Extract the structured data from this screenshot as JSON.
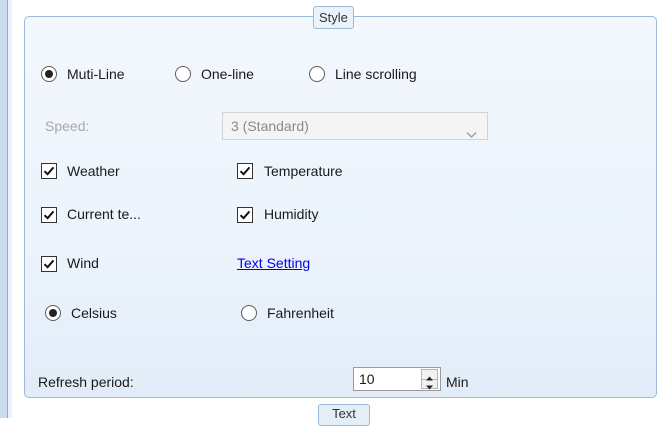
{
  "group": {
    "title": "Style",
    "bottom_tab": "Text"
  },
  "mode": {
    "options": [
      {
        "label": "Muti-Line",
        "selected": true
      },
      {
        "label": "One-line",
        "selected": false
      },
      {
        "label": "Line scrolling",
        "selected": false
      }
    ]
  },
  "speed": {
    "label": "Speed:",
    "value": "3 (Standard)",
    "enabled": false
  },
  "checkboxes": [
    {
      "label": "Weather",
      "checked": true
    },
    {
      "label": "Temperature",
      "checked": true
    },
    {
      "label": "Current te...",
      "checked": true
    },
    {
      "label": "Humidity",
      "checked": true
    },
    {
      "label": "Wind",
      "checked": true
    }
  ],
  "text_setting_link": "Text Setting",
  "units": {
    "options": [
      {
        "label": "Celsius",
        "selected": true
      },
      {
        "label": "Fahrenheit",
        "selected": false
      }
    ]
  },
  "refresh": {
    "label": "Refresh period:",
    "value": "10",
    "unit": "Min"
  },
  "icons": {
    "dropdown": "chevron-down-icon",
    "spinner": "spinner-arrows-icon",
    "check": "checkmark-icon"
  },
  "colors": {
    "group_border": "#9db9d9",
    "group_background": "#eaf2fb",
    "link": "#0000ee"
  }
}
